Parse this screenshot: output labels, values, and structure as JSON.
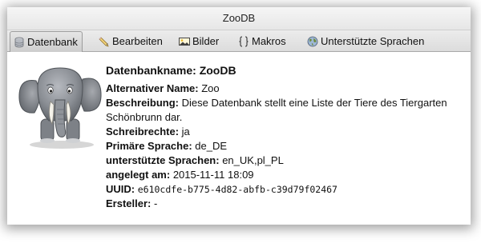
{
  "window": {
    "title": "ZooDB"
  },
  "tabs": [
    {
      "label": "Datenbank",
      "icon": "database-icon",
      "active": true
    },
    {
      "label": "Bearbeiten",
      "icon": "pencil-icon",
      "active": false
    },
    {
      "label": "Bilder",
      "icon": "image-icon",
      "active": false
    },
    {
      "label": "Makros",
      "icon": "script-icon",
      "active": false
    },
    {
      "label": "Unterstützte Sprachen",
      "icon": "globe-icon",
      "active": false
    }
  ],
  "db": {
    "heading_label": "Datenbankname:",
    "heading_value": "ZooDB",
    "fields": [
      {
        "label": "Alternativer Name:",
        "value": "Zoo"
      },
      {
        "label": "Beschreibung:",
        "value": "Diese Datenbank stellt eine Liste der Tiere des Tiergarten Schönbrunn dar."
      },
      {
        "label": "Schreibrechte:",
        "value": "ja"
      },
      {
        "label": "Primäre Sprache:",
        "value": "de_DE"
      },
      {
        "label": "unterstützte Sprachen:",
        "value": "en_UK,pl_PL"
      },
      {
        "label": "angelegt am:",
        "value": "2015-11-11 18:09"
      },
      {
        "label": "UUID:",
        "value": "e610cdfe-b775-4d82-abfb-c39d79f02467"
      },
      {
        "label": "Ersteller:",
        "value": "-"
      }
    ]
  },
  "colors": {
    "elephant": "#8a8e94",
    "tab_active": "#d6d6d6",
    "window_shadow": "#000000"
  }
}
